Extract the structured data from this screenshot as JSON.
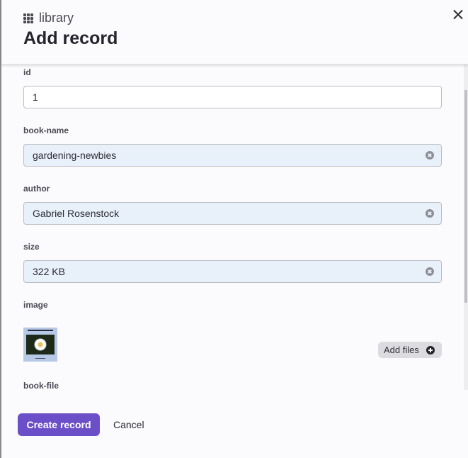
{
  "header": {
    "breadcrumb": "library",
    "breadcrumb_icon": "grid-icon",
    "title": "Add record",
    "close_icon": "close-icon"
  },
  "fields": [
    {
      "label": "id",
      "value": "1",
      "filled": false
    },
    {
      "label": "book-name",
      "value": "gardening-newbies",
      "filled": true
    },
    {
      "label": "author",
      "value": "Gabriel Rosenstock",
      "filled": true
    },
    {
      "label": "size",
      "value": "322 KB",
      "filled": true
    }
  ],
  "image_field": {
    "label": "image",
    "thumbnail_alt": "book cover with white water lily",
    "add_files_label": "Add files",
    "add_icon": "plus-circle-icon"
  },
  "book_file_field": {
    "label": "book-file"
  },
  "footer": {
    "create_label": "Create record",
    "cancel_label": "Cancel"
  },
  "colors": {
    "primary": "#6b4fc8",
    "filled_input_bg": "#e8f0fa"
  }
}
